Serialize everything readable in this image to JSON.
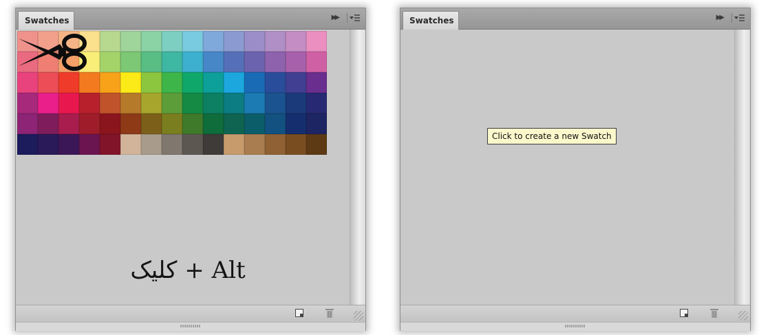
{
  "panels": {
    "left": {
      "tab_label": "Swatches",
      "caption": "کلیک + Alt"
    },
    "right": {
      "tab_label": "Swatches",
      "tooltip": "Click to create a new Swatch"
    }
  },
  "swatches": [
    "#f0928c",
    "#f2a08c",
    "#f5b486",
    "#fbe08d",
    "#b7d98f",
    "#9fd49a",
    "#8bd2a4",
    "#7ccfc1",
    "#79cbe0",
    "#80a9db",
    "#8b9ad0",
    "#9b8dc8",
    "#b08fc6",
    "#c48ec5",
    "#eb8fc1",
    "#ea6a80",
    "#ee7f72",
    "#f4a068",
    "#f9ee77",
    "#a4d36a",
    "#7cc875",
    "#58be84",
    "#3eb7a3",
    "#3cb0ce",
    "#4787c8",
    "#5570b8",
    "#6c63ae",
    "#8e62ad",
    "#a760ab",
    "#d060a4",
    "#e9437e",
    "#ec4d57",
    "#ef3b29",
    "#f47a1f",
    "#f8a21a",
    "#fbea17",
    "#8cc63e",
    "#3eb549",
    "#10a76b",
    "#0d9f9a",
    "#1ca7de",
    "#1a6bb6",
    "#2a4d9b",
    "#403f92",
    "#6a2e8e",
    "#a7297c",
    "#ea1f8a",
    "#e8184f",
    "#b8202c",
    "#c0532a",
    "#b57a2a",
    "#a7a52c",
    "#5c9d3a",
    "#148a45",
    "#0d7f63",
    "#0b7d83",
    "#1c7bb3",
    "#1b5390",
    "#1a3a7a",
    "#272972",
    "#8d2476",
    "#7f1d5c",
    "#a81d4e",
    "#9f1d2a",
    "#8b151d",
    "#8e3a17",
    "#7c5f19",
    "#7b7e1e",
    "#3f7a2b",
    "#0f6c3b",
    "#0f6451",
    "#0b5d6a",
    "#135180",
    "#152f6e",
    "#1d2563",
    "#1c1b5c",
    "#2a1a5a",
    "#3c1757",
    "#6b1550",
    "#82142a",
    "#d2b49a",
    "#a89b8b",
    "#80776f",
    "#5d5752",
    "#3e3b39",
    "#c79b6c",
    "#a97d50",
    "#8f6134",
    "#7a4d21",
    "#5d3a14"
  ]
}
